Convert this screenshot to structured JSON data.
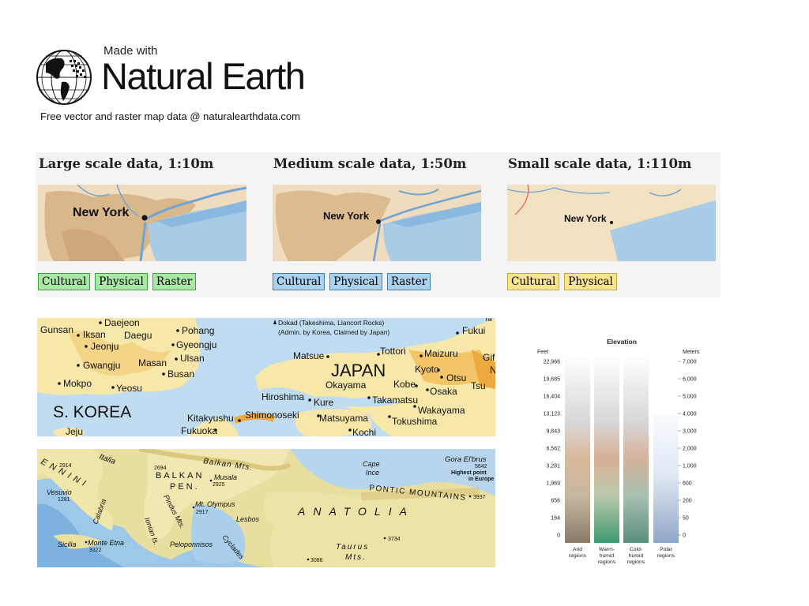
{
  "header": {
    "made_with": "Made with",
    "brand": "Natural Earth",
    "tagline": "Free vector and raster map data @ naturalearthdata.com"
  },
  "scales": [
    {
      "title": "Large scale data, 1:10m",
      "city": "New York",
      "buttons": [
        "Cultural",
        "Physical",
        "Raster"
      ],
      "button_color": "#a9e8a4",
      "button_border": "#3aa53a"
    },
    {
      "title": "Medium scale data, 1:50m",
      "city": "New York",
      "buttons": [
        "Cultural",
        "Physical",
        "Raster"
      ],
      "button_color": "#a8d2ee",
      "button_border": "#3e7fae"
    },
    {
      "title": "Small scale data, 1:110m",
      "city": "New York",
      "buttons": [
        "Cultural",
        "Physical"
      ],
      "button_color": "#f6e48f",
      "button_border": "#c3a83a"
    }
  ],
  "japan_map": {
    "cities": [
      "Gunsan",
      "Daejeon",
      "Iksan",
      "Daegu",
      "Pohang",
      "Jeonju",
      "Gyeongju",
      "Ulsan",
      "Masan",
      "Gwangju",
      "Busan",
      "Mokpo",
      "Yeosu",
      "Jeju",
      "Matsue",
      "Tottori",
      "Maizuru",
      "Fukui",
      "Kyoto",
      "Otsu",
      "Tsu",
      "Kobe",
      "Osaka",
      "Okayama",
      "Hiroshima",
      "Kure",
      "Takamatsu",
      "Wakayama",
      "Matsuyama",
      "Tokushima",
      "Kochi",
      "Kitakyushu",
      "Shimonoseki",
      "Fukuoka",
      "Gif",
      "N",
      "Ta"
    ],
    "countries": [
      "S. KOREA",
      "JAPAN"
    ],
    "annotation_1": "Dokad (Takeshima, Liancort Rocks)",
    "annotation_2": "(Admin. by Korea, Claimed by Japan)"
  },
  "europe_map": {
    "labels": [
      "Balkan Mts.",
      "BALKAN",
      "PEN.",
      "Musala",
      "2925",
      "2694",
      "2914",
      "Vesuvio",
      "1281",
      "Calabria",
      "Pindus Mts.",
      "Mt. Olympus",
      "2917",
      "Lesbos",
      "Ionian Is.",
      "Peloponnisos",
      "Cyclades",
      "Sicilia",
      "Monte Etna",
      "3322",
      "Cape",
      "Ince",
      "PONTIC MOUNTAINS",
      "3937",
      "ANATOLIA",
      "3734",
      "Taurus",
      "Mts.",
      "3086",
      "Gora El'brus",
      "5642",
      "Highest point",
      "in Europe",
      "Italia",
      "ENNINI"
    ]
  },
  "elevation": {
    "title": "Elevation",
    "feet_label": "Feet",
    "meters_label": "Meters",
    "feet_ticks": [
      "22,966",
      "19,685",
      "16,404",
      "13,123",
      "9,843",
      "6,562",
      "3,281",
      "1,969",
      "656",
      "164",
      "0"
    ],
    "meters_ticks": [
      "7,000",
      "6,000",
      "5,000",
      "4,000",
      "3,000",
      "2,000",
      "1,000",
      "600",
      "200",
      "50",
      "0"
    ],
    "columns": [
      {
        "label_1": "Arid",
        "label_2": "regions",
        "label_3": ""
      },
      {
        "label_1": "Warm-",
        "label_2": "humid",
        "label_3": "regions"
      },
      {
        "label_1": "Cold-",
        "label_2": "humid",
        "label_3": "regions"
      },
      {
        "label_1": "Polar",
        "label_2": "regions",
        "label_3": ""
      }
    ]
  }
}
